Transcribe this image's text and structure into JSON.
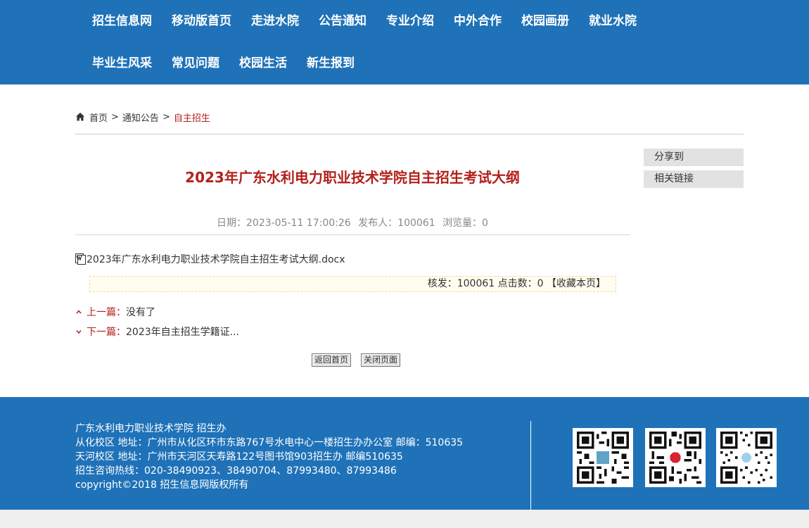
{
  "nav": {
    "items": [
      "招生信息网",
      "移动版首页",
      "走进水院",
      "公告通知",
      "专业介绍",
      "中外合作",
      "校园画册",
      "就业水院",
      "毕业生风采",
      "常见问题",
      "校园生活",
      "新生报到"
    ]
  },
  "breadcrumb": {
    "home": "首页",
    "sep": ">",
    "level1": "通知公告",
    "current": "自主招生"
  },
  "article": {
    "title": "2023年广东水利电力职业技术学院自主招生考试大纲",
    "date": "日期：2023-05-11 17:00:26",
    "publisher": "发布人：100061",
    "views": "浏览量：0",
    "attachment": "2023年广东水利电力职业技术学院自主招生考试大纲.docx",
    "stats": "核发：100061 点击数：0",
    "favorite": "【收藏本页】",
    "prev_label": "上一篇：",
    "prev_text": "没有了",
    "next_label": "下一篇：",
    "next_text": "2023年自主招生学籍证..."
  },
  "buttons": {
    "home": "返回首页",
    "close": "关闭页面"
  },
  "sidebar": {
    "share": "分享到",
    "links": "相关链接"
  },
  "footer": {
    "lines": [
      "广东水利电力职业技术学院 招生办",
      "从化校区 地址：广州市从化区环市东路767号水电中心一楼招生办办公室 邮编：510635",
      "天河校区 地址：广州市天河区天寿路122号图书馆903招生办 邮编510635",
      "招生咨询热线：020-38490923、38490704、87993480、87993486",
      "copyright©2018 招生信息网版权所有"
    ]
  },
  "colors": {
    "brand_blue": "#1f72b8",
    "accent_red": "#b3201a"
  },
  "icons": [
    "home-icon",
    "document-icon",
    "chevron-up-icon",
    "chevron-down-icon",
    "qr-code-icon"
  ]
}
